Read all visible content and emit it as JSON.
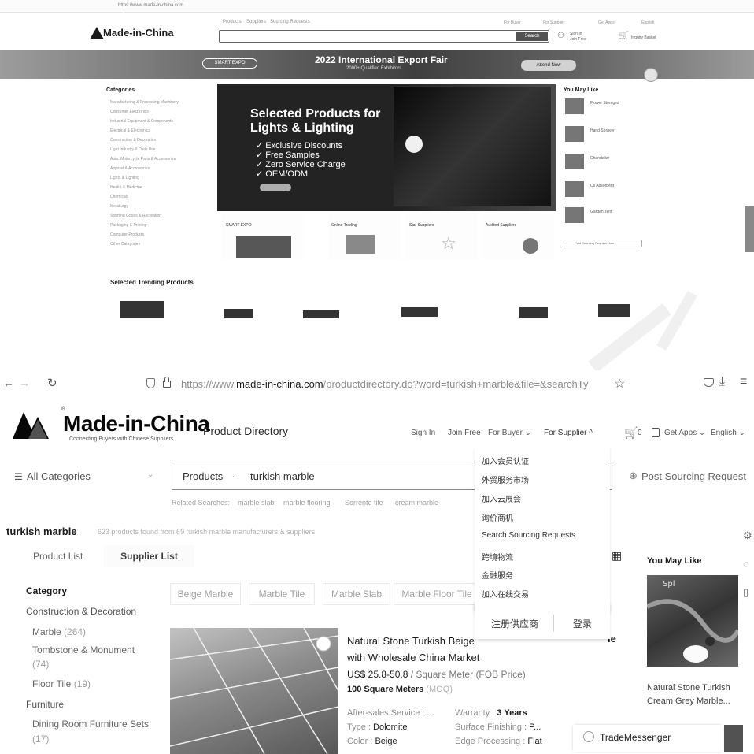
{
  "top_screenshot": {
    "browser_url": "https://www.made-in-china.com",
    "header": {
      "nav_links": [
        "Products",
        "Suppliers",
        "Sourcing Requests"
      ],
      "right_links": [
        "For Buyer",
        "For Supplier",
        "Get Apps",
        "English"
      ],
      "sign_in": "Sign In",
      "join_free": "Join Free",
      "search_button": "Search",
      "inquiry_basket": "Inquiry Basket"
    },
    "logo": "Made-in-China",
    "banner": {
      "pill": "SMART EXPO",
      "title": "2022 International Export Fair",
      "subtitle": "2000+ Qualified Exhibitors",
      "cta": "Attend Now"
    },
    "categories": {
      "title": "Categories",
      "items": [
        "Manufacturing & Processing Machinery",
        "Consumer Electronics",
        "Industrial Equipment & Components",
        "Electrical & Electronics",
        "Construction & Decoration",
        "Light Industry & Daily Use",
        "Auto, Motorcycle Parts & Accessories",
        "Apparel & Accessories",
        "Lights & Lighting",
        "Health & Medicine",
        "Chemicals",
        "Metallurgy",
        "Sporting Goods & Recreation",
        "Packaging & Printing",
        "Computer Products",
        "Other Categories"
      ]
    },
    "hero": {
      "title_line1": "Selected Products for",
      "title_line2": "Lights & Lighting",
      "bullets": [
        "Exclusive Discounts",
        "Free Samples",
        "Zero Service Charge",
        "OEM/ODM"
      ]
    },
    "tiles": [
      "SMART EXPO",
      "Online Trading",
      "Star Suppliers",
      "Audited Suppliers"
    ],
    "you_may_like": {
      "title": "You May Like",
      "items": [
        "Flower Storages",
        "Hand Sprayer",
        "Chandelier",
        "Oil Absorbent",
        "Garden Tent"
      ],
      "footer": "Post Sourcing Request Now"
    },
    "trending_title": "Selected Trending Products"
  },
  "browser": {
    "url_prefix": "https://www.",
    "url_domain": "made-in-china.com",
    "url_rest": "/productdirectory.do?word=turkish+marble&file=&searchTy"
  },
  "header": {
    "logo": "Made-in-China",
    "tagline": "Connecting Buyers with Chinese Suppliers",
    "section": "Product Directory",
    "sign_in": "Sign In",
    "join_free": "Join Free",
    "for_buyer": "For Buyer",
    "for_supplier": "For Supplier",
    "cart_count": "0",
    "get_apps": "Get Apps",
    "language": "English"
  },
  "search": {
    "all_categories": "All Categories",
    "type": "Products",
    "query": "turkish marble",
    "post_sourcing": "Post Sourcing Request",
    "related_label": "Related Searches:",
    "related": [
      "marble slab",
      "marble flooring",
      "Sorrento tile",
      "cream marble"
    ]
  },
  "results": {
    "keyword": "turkish marble",
    "summary": "623 products found from 69 turkish marble manufacturers & suppliers"
  },
  "tabs": [
    "Product List",
    "Supplier List"
  ],
  "category_panel": {
    "title": "Category",
    "groups": [
      {
        "name": "Construction & Decoration",
        "subs": [
          {
            "name": "Marble",
            "count": "(264)"
          },
          {
            "name": "Tombstone & Monument",
            "count": "(74)"
          },
          {
            "name": "Floor Tile",
            "count": "(19)"
          }
        ]
      },
      {
        "name": "Furniture",
        "subs": [
          {
            "name": "Dining Room Furniture Sets",
            "count": "(17)"
          }
        ]
      }
    ]
  },
  "filter_chips": [
    "Beige Marble",
    "Marble Tile",
    "Marble Slab",
    "Marble Floor Tile"
  ],
  "product": {
    "title_line1": "Natural Stone Turkish Beige",
    "title_line2": "with Wholesale China Market",
    "title_suffix": "le",
    "price": "US$ 25.8-50.8",
    "price_unit": "/ Square Meter (FOB Price)",
    "moq": "100 Square Meters",
    "moq_tag": "(MOQ)",
    "attributes": [
      {
        "k": "After-sales Service :",
        "v": "..."
      },
      {
        "k": "Warranty :",
        "v": "3 Years"
      },
      {
        "k": "Type :",
        "v": "Dolomite"
      },
      {
        "k": "Surface Finishing :",
        "v": "P..."
      },
      {
        "k": "Color :",
        "v": "Beige"
      },
      {
        "k": "Edge Processing :",
        "v": "Flat"
      }
    ]
  },
  "supplier_dropdown": {
    "items": [
      "加入会员认证",
      "外贸服务市场",
      "加入云展会",
      "询价商机",
      "Search Sourcing Requests",
      "跨境物流",
      "金融服务",
      "加入在线交易"
    ],
    "register": "注册供应商",
    "login": "登录"
  },
  "you_may_like": {
    "title": "You May Like",
    "item_name": "Natural Stone Turkish Cream Grey Marble..."
  },
  "trade_messenger": "TradeMessenger"
}
